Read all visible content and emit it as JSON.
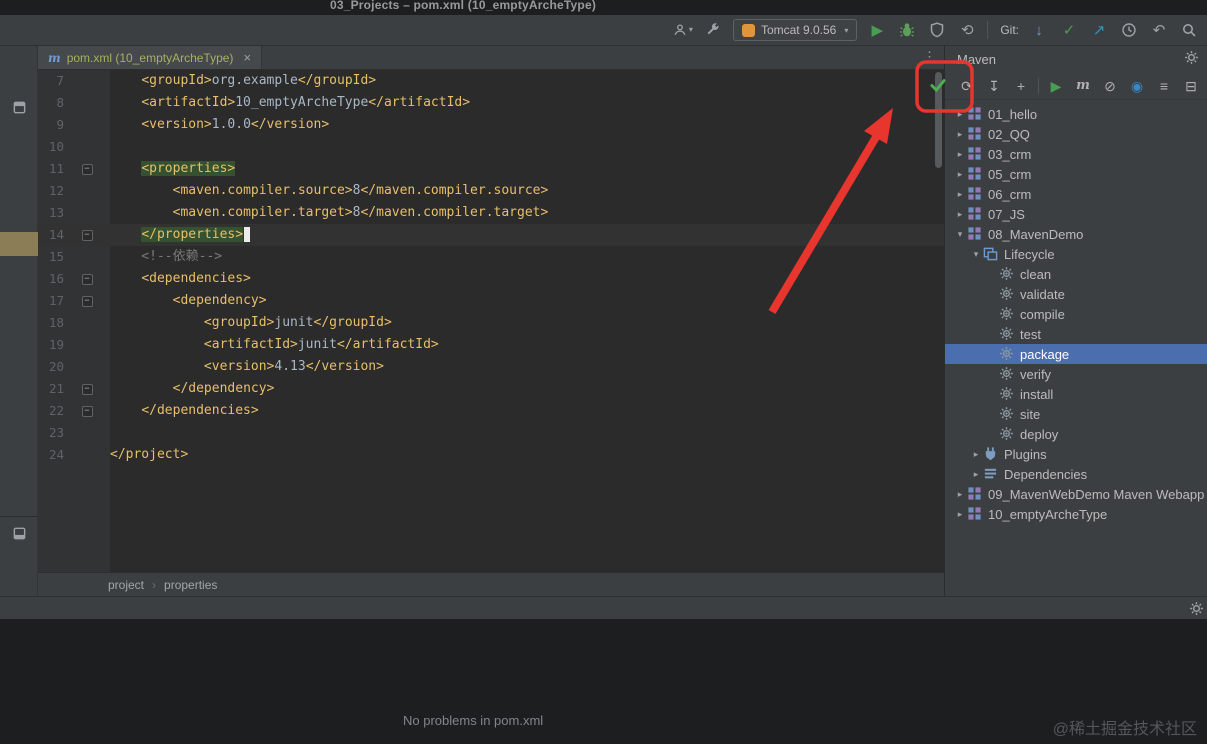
{
  "window": {
    "title": "03_Projects – pom.xml (10_emptyArcheType)"
  },
  "toolbar": {
    "run_config": "Tomcat 9.0.56",
    "git_label": "Git:"
  },
  "tabs": [
    {
      "label": "pom.xml (10_emptyArcheType)"
    }
  ],
  "editor": {
    "breadcrumbs": [
      "project",
      "properties"
    ],
    "lines": [
      {
        "num": 7,
        "code": "    <groupId>org.example</groupId>"
      },
      {
        "num": 8,
        "code": "    <artifactId>10_emptyArcheType</artifactId>"
      },
      {
        "num": 9,
        "code": "    <version>1.0.0</version>"
      },
      {
        "num": 10,
        "code": ""
      },
      {
        "num": 11,
        "code": "    <properties>",
        "fold": "start",
        "mark": true
      },
      {
        "num": 12,
        "code": "        <maven.compiler.source>8</maven.compiler.source>"
      },
      {
        "num": 13,
        "code": "        <maven.compiler.target>8</maven.compiler.target>"
      },
      {
        "num": 14,
        "code": "    </properties>",
        "fold": "end",
        "mark": true,
        "caret": true
      },
      {
        "num": 15,
        "code": "    <!--依赖-->"
      },
      {
        "num": 16,
        "code": "    <dependencies>",
        "fold": "start"
      },
      {
        "num": 17,
        "code": "        <dependency>",
        "fold": "start"
      },
      {
        "num": 18,
        "code": "            <groupId>junit</groupId>"
      },
      {
        "num": 19,
        "code": "            <artifactId>junit</artifactId>"
      },
      {
        "num": 20,
        "code": "            <version>4.13</version>"
      },
      {
        "num": 21,
        "code": "        </dependency>",
        "fold": "end"
      },
      {
        "num": 22,
        "code": "    </dependencies>",
        "fold": "end"
      },
      {
        "num": 23,
        "code": ""
      },
      {
        "num": 24,
        "code": "</project>"
      }
    ]
  },
  "maven": {
    "title": "Maven",
    "tree": [
      {
        "label": "01_hello",
        "icon": "maven-project",
        "chevron": "right",
        "depth": 0
      },
      {
        "label": "02_QQ",
        "icon": "maven-project",
        "chevron": "right",
        "depth": 0
      },
      {
        "label": "03_crm",
        "icon": "maven-project",
        "chevron": "right",
        "depth": 0
      },
      {
        "label": "05_crm",
        "icon": "maven-project",
        "chevron": "right",
        "depth": 0
      },
      {
        "label": "06_crm",
        "icon": "maven-project",
        "chevron": "right",
        "depth": 0
      },
      {
        "label": "07_JS",
        "icon": "maven-project",
        "chevron": "right",
        "depth": 0
      },
      {
        "label": "08_MavenDemo",
        "icon": "maven-project",
        "chevron": "down",
        "depth": 0
      },
      {
        "label": "Lifecycle",
        "icon": "lifecycle",
        "chevron": "down",
        "depth": 1
      },
      {
        "label": "clean",
        "icon": "goal",
        "depth": 2
      },
      {
        "label": "validate",
        "icon": "goal",
        "depth": 2
      },
      {
        "label": "compile",
        "icon": "goal",
        "depth": 2
      },
      {
        "label": "test",
        "icon": "goal",
        "depth": 2
      },
      {
        "label": "package",
        "icon": "goal",
        "depth": 2,
        "selected": true
      },
      {
        "label": "verify",
        "icon": "goal",
        "depth": 2
      },
      {
        "label": "install",
        "icon": "goal",
        "depth": 2
      },
      {
        "label": "site",
        "icon": "goal",
        "depth": 2
      },
      {
        "label": "deploy",
        "icon": "goal",
        "depth": 2
      },
      {
        "label": "Plugins",
        "icon": "plugins",
        "chevron": "right",
        "depth": 1
      },
      {
        "label": "Dependencies",
        "icon": "dependencies",
        "chevron": "right",
        "depth": 1
      },
      {
        "label": "09_MavenWebDemo Maven Webapp",
        "icon": "maven-project",
        "chevron": "right",
        "depth": 0
      },
      {
        "label": "10_emptyArcheType",
        "icon": "maven-project",
        "chevron": "right",
        "depth": 0
      }
    ]
  },
  "status": {
    "message": "No problems in pom.xml"
  },
  "watermark": "@稀土掘金技术社区",
  "icons": {
    "chevron_right": "▸",
    "chevron_down": "▾",
    "dropdown_arrow": "▾",
    "close": "×",
    "more": "⋮",
    "refresh": "⟳",
    "download": "↧",
    "plus": "+",
    "run": "▶",
    "maven_m": "m",
    "skip_tests": "⊘",
    "offline": "◉",
    "profiles": "≡",
    "collapse": "⊟",
    "git_update": "↓",
    "git_commit": "✓",
    "git_push": "↗",
    "git_rollback": "↶",
    "rerun": "⟲",
    "breadcrumb_sep": "›",
    "fold_minus": "−"
  },
  "colors": {
    "selection_blue": "#4b6eaf",
    "annotation_red": "#e8352e",
    "check_green": "#4caf50",
    "tag_yellow": "#e8bf6a"
  }
}
